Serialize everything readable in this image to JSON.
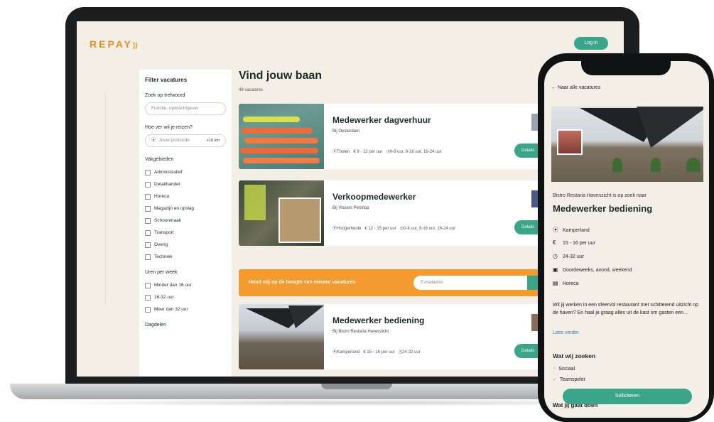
{
  "laptop": {
    "logo": "REPAY",
    "logo_mark": "))",
    "login_label": "Log in",
    "sidebar": {
      "title": "Filter vacatures",
      "search_label": "Zoek op trefwoord",
      "search_placeholder": "Functie, opdrachtgever",
      "travel_label": "Hoe ver wil je reizen?",
      "postcode_placeholder": "Jouw postcode",
      "km": "+10 km",
      "fields_label": "Vakgebieden",
      "fields": [
        "Administratief",
        "Detailhandel",
        "Horeca",
        "Magazijn en opslag",
        "Schoonmaak",
        "Transport",
        "Overig",
        "Techniek"
      ],
      "hours_label": "Uren per week",
      "hours": [
        "Minder dan 16 uur",
        "16-32 uur",
        "Meer dan 32 uur"
      ],
      "dayparts_label": "Dagdelen"
    },
    "main": {
      "title": "Vind jouw baan",
      "count": "48 vacatures",
      "jobs": [
        {
          "title": "Medewerker dagverhuur",
          "company": "Bij Oesterdam",
          "location": "Tholen",
          "pay": "€ 9 - 12 per uur",
          "hours": "0-8 uur, 8-16 uur, 16-24 uur",
          "button": "Details"
        },
        {
          "title": "Verkoopmedewerker",
          "company": "Bij Vissers Petshop",
          "location": "Hoogerheide",
          "pay": "€ 12 - 15 per uur",
          "hours": "0-8 uur, 8-16 uur, 16-24 uur",
          "button": "Details"
        },
        {
          "title": "Medewerker bediening",
          "company": "Bij Bistro Restaria Havenzicht",
          "location": "Kamperland",
          "pay": "€ 15 - 16 per uur",
          "hours": "24-32 uur",
          "button": "Details"
        }
      ],
      "newsletter_text": "Houd mij op de hoogte van nieuwe vacatures",
      "newsletter_placeholder": "E-mailadres"
    }
  },
  "phone": {
    "back": "← Naar alle vacatures",
    "company": "Bistro Restaria Havenzicht is op zoek naar",
    "title": "Medewerker bediening",
    "location": "Kamperland",
    "pay": "15 - 16 per uur",
    "hours": "24-32 uur",
    "schedule": "Doordeweeks, avond, weekend",
    "sector": "Horeca",
    "description": "Wil jij werken in een sfeervol restaurant met schitterend uitzicht op de haven? En haal je graag alles uit de kast om gasten een...",
    "read_more": "Lees verder",
    "looking_for_title": "Wat wij zoeken",
    "traits": [
      "Sociaal",
      "Teamspeler"
    ],
    "apply": "Solliciteren",
    "next_title": "Wat jij gaat doen"
  },
  "colors": {
    "accent": "#3aa589",
    "brand": "#e8901f",
    "newsletter": "#f39b2f",
    "page": "#f4efe6"
  }
}
